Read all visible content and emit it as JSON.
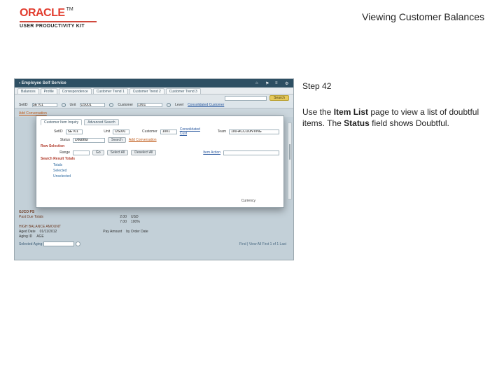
{
  "document": {
    "brand": "ORACLE",
    "brand_tm": "TM",
    "upk": "USER PRODUCTIVITY KIT",
    "title": "Viewing Customer Balances"
  },
  "instructions": {
    "step_label": "Step 42",
    "p1a": "Use the ",
    "p1b": "Item List",
    "p1c": " page to view a list of doubtful items. The ",
    "p1d": "Status",
    "p1e": " field shows Doubtful."
  },
  "shot": {
    "app_title": "Employee Self Service",
    "tabs": [
      "Balances",
      "Profile",
      "Correspondence",
      "Customer Trend 1",
      "Customer Trend 2",
      "Customer Trend 3"
    ],
    "search_btn": "Search",
    "filter": {
      "setid_lbl": "SetID",
      "setid": "SET01",
      "unit_lbl": "Unit",
      "unit": "US001",
      "cust_lbl": "Customer",
      "cust": "1001",
      "level_lbl": "Level",
      "level": "Consolidated Customer"
    },
    "link_add": "Add Conversation",
    "modal": {
      "tabs": [
        "Customer Item Inquiry",
        "Advanced Search"
      ],
      "row1": {
        "setid_lbl": "SetID",
        "setid": "SET01",
        "unit_lbl": "Unit",
        "unit": "US001",
        "cust_lbl": "Customer",
        "cust": "1001",
        "link": "Consolidated Cust",
        "team_lbl": "Team",
        "team": "100-ACCOUNTING"
      },
      "row2": {
        "status_lbl": "Status",
        "status": "Doubtful",
        "search": "Search",
        "link": "Add Conversation"
      },
      "rowsel_header": "Row Selection",
      "rowsel": {
        "range_lbl": "Range",
        "go": "Go",
        "sel_all": "Select All",
        "desel_all": "Deselect All"
      },
      "link_item": "Item Action",
      "results_header": "Search Result Totals",
      "list_rows": [
        "Totals",
        "Selected",
        "Unselected"
      ],
      "currency": "Currency"
    },
    "bottom": {
      "header": "GJCO PS",
      "rows": [
        {
          "label": "Past Due Totals",
          "a": "2.00",
          "b": "USD"
        },
        {
          "label": "",
          "a": "7.00",
          "b": "100%"
        }
      ],
      "line1_label": "HIGH BALANCE AMOUNT",
      "line2_lbl_a": "Aged Date",
      "line2_val_a": "01/11/2012",
      "line2_lbl_b": "Pay Amount",
      "line2_val_b": "by Order Date",
      "line3_lbl_a": "Aging ID",
      "line3_val_a": "AGE",
      "footer_opt": "Selected Aging",
      "footer_pager": "Find | View All    First  1 of 1  Last"
    }
  }
}
